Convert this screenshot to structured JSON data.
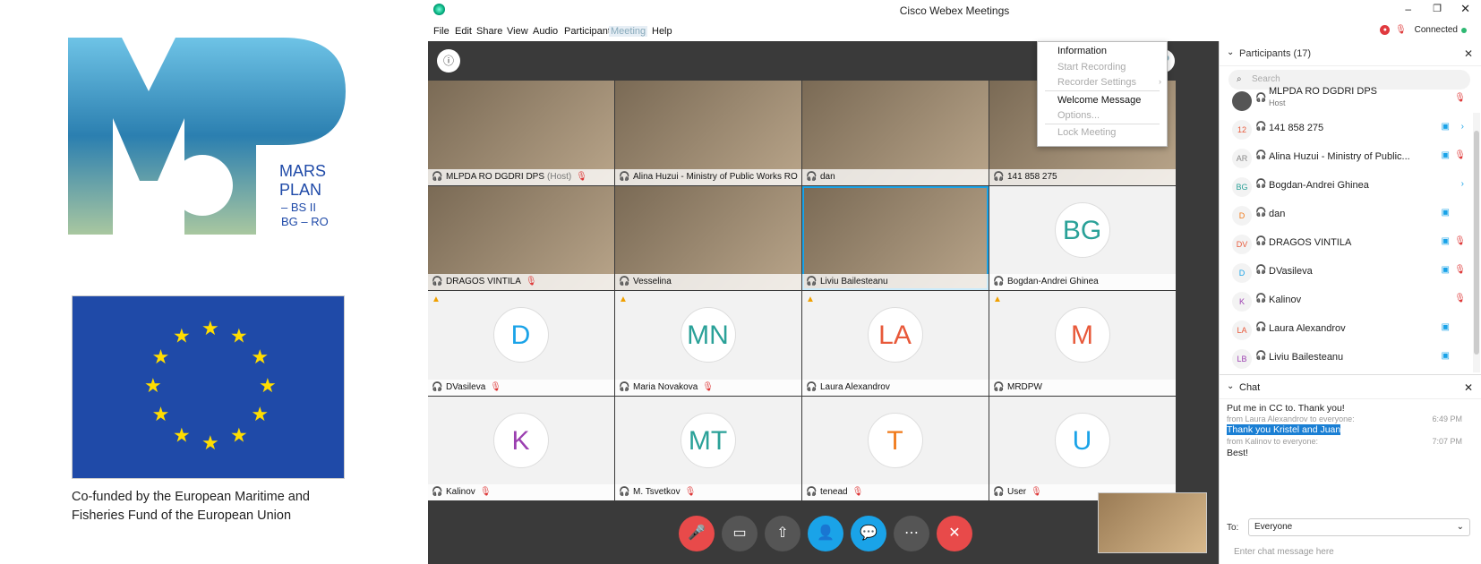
{
  "branding": {
    "logo_text": [
      "MARS",
      "PLAN",
      "– BS II",
      "BG – RO"
    ],
    "cofund_line1": "Co-funded by the European Maritime and",
    "cofund_line2": "Fisheries Fund of the European Union"
  },
  "window": {
    "title": "Cisco Webex Meetings",
    "connection": "Connected",
    "menu": [
      "File",
      "Edit",
      "Share",
      "View",
      "Audio",
      "Participant",
      "Meeting",
      "Help"
    ]
  },
  "meeting_menu": {
    "items": [
      {
        "label": "Information",
        "enabled": true
      },
      {
        "label": "Start Recording",
        "enabled": false
      },
      {
        "label": "Recorder Settings",
        "enabled": false
      },
      {
        "label": "Welcome Message",
        "enabled": true
      },
      {
        "label": "Options...",
        "enabled": false
      },
      {
        "label": "Lock Meeting",
        "enabled": false
      }
    ]
  },
  "tiles": [
    {
      "name": "MLPDA RO DGDRI DPS",
      "suffix": "(Host)",
      "muted": true,
      "video": true
    },
    {
      "name": "Alina Huzui - Ministry of Public Works RO",
      "muted": true,
      "video": true
    },
    {
      "name": "dan",
      "muted": false,
      "video": true
    },
    {
      "name": "141 858 275",
      "muted": false,
      "video": true
    },
    {
      "name": "DRAGOS VINTILA",
      "muted": true,
      "video": true
    },
    {
      "name": "Vesselina",
      "muted": false,
      "video": true
    },
    {
      "name": "Liviu Bailesteanu",
      "muted": false,
      "video": true,
      "selected": true
    },
    {
      "name": "Bogdan-Andrei Ghinea",
      "initials": "BG",
      "color": "#2aa198",
      "muted": false
    },
    {
      "name": "DVasileva",
      "initials": "D",
      "color": "#1aa3e8",
      "muted": true,
      "warn": true
    },
    {
      "name": "Maria Novakova",
      "initials": "MN",
      "color": "#2aa198",
      "muted": true,
      "warn": true
    },
    {
      "name": "Laura Alexandrov",
      "initials": "LA",
      "color": "#e8593a",
      "muted": false,
      "warn": true
    },
    {
      "name": "MRDPW",
      "initials": "M",
      "color": "#e8593a",
      "muted": false,
      "warn": true
    },
    {
      "name": "Kalinov",
      "initials": "K",
      "color": "#9b3fb0",
      "muted": true
    },
    {
      "name": "M. Tsvetkov",
      "initials": "MT",
      "color": "#2aa198",
      "muted": true
    },
    {
      "name": "tenead",
      "initials": "T",
      "color": "#f07a1a",
      "muted": true
    },
    {
      "name": "User",
      "initials": "U",
      "color": "#1aa3e8",
      "muted": true
    }
  ],
  "participants": {
    "title": "Participants (17)",
    "search_placeholder": "Search",
    "list": [
      {
        "initials": "",
        "name": "MLPDA RO DGDRI DPS",
        "sub": "Host",
        "mic": true
      },
      {
        "initials": "12",
        "name": "141 858 275",
        "cam": true,
        "chev": true,
        "color": "#e8593a"
      },
      {
        "initials": "AR",
        "name": "Alina Huzui - Ministry of Public...",
        "cam": true,
        "mic": true,
        "color": "#888"
      },
      {
        "initials": "BG",
        "name": "Bogdan-Andrei Ghinea",
        "chev": true,
        "color": "#2aa198"
      },
      {
        "initials": "D",
        "name": "dan",
        "cam": true,
        "color": "#f07a1a"
      },
      {
        "initials": "DV",
        "name": "DRAGOS VINTILA",
        "cam": true,
        "mic": true,
        "color": "#e8593a"
      },
      {
        "initials": "D",
        "name": "DVasileva",
        "cam": true,
        "mic": true,
        "color": "#1aa3e8"
      },
      {
        "initials": "K",
        "name": "Kalinov",
        "mic": true,
        "color": "#9b3fb0"
      },
      {
        "initials": "LA",
        "name": "Laura Alexandrov",
        "cam": true,
        "color": "#e8593a"
      },
      {
        "initials": "LB",
        "name": "Liviu Bailesteanu",
        "cam": true,
        "color": "#9b3fb0"
      }
    ]
  },
  "chat": {
    "title": "Chat",
    "messages": [
      {
        "text": "Put me in CC to. Thank you!"
      },
      {
        "meta": "from Laura Alexandrov to everyone:",
        "time": "6:49 PM"
      },
      {
        "text": "Thank you Kristel and Juan",
        "highlight": true
      },
      {
        "meta": "from Kalinov to everyone:",
        "time": "7:07 PM"
      },
      {
        "text": "Best!"
      }
    ],
    "to_label": "To:",
    "to_value": "Everyone",
    "input_placeholder": "Enter chat message here"
  },
  "colors": {
    "accent": "#1aa3e8",
    "end": "#e84a4a",
    "mute": "#e84a4a",
    "warn": "#f0a000"
  }
}
